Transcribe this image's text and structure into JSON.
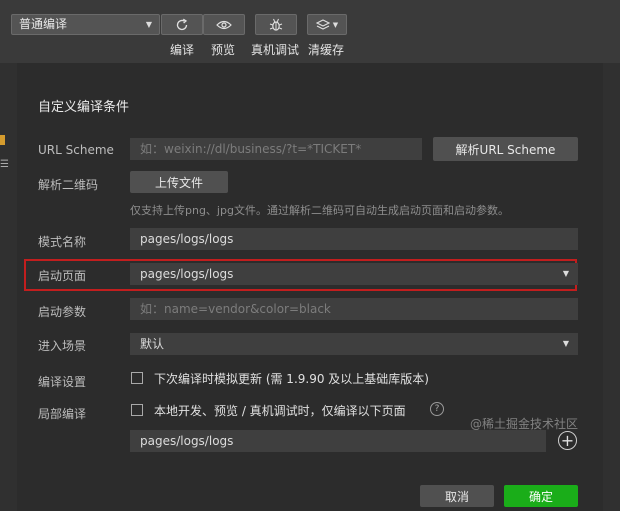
{
  "toolbar": {
    "mode_select": "普通编译",
    "compile_label": "编译",
    "preview_label": "预览",
    "debug_label": "真机调试",
    "clear_cache_label": "清缓存"
  },
  "dialog": {
    "title": "自定义编译条件",
    "url_scheme_label": "URL Scheme",
    "url_scheme_placeholder": "如：weixin://dl/business/?t=*TICKET*",
    "parse_url_button": "解析URL Scheme",
    "qr_label": "解析二维码",
    "upload_button": "上传文件",
    "qr_hint": "仅支持上传png、jpg文件。通过解析二维码可自动生成启动页面和启动参数。",
    "mode_name_label": "模式名称",
    "mode_name_value": "pages/logs/logs",
    "start_page_label": "启动页面",
    "start_page_value": "pages/logs/logs",
    "start_params_label": "启动参数",
    "start_params_placeholder": "如：name=vendor&color=black",
    "scene_label": "进入场景",
    "scene_value": "默认",
    "compile_settings_label": "编译设置",
    "compile_settings_option": "下次编译时模拟更新 (需 1.9.90 及以上基础库版本)",
    "partial_compile_label": "局部编译",
    "partial_compile_option": "本地开发、预览 / 真机调试时，仅编译以下页面",
    "partial_page_value": "pages/logs/logs",
    "cancel_button": "取消",
    "confirm_button": "确定"
  },
  "watermark": "@稀土掘金技术社区",
  "colors": {
    "confirm_green": "#1aad19",
    "highlight_red": "#c21e1e"
  }
}
